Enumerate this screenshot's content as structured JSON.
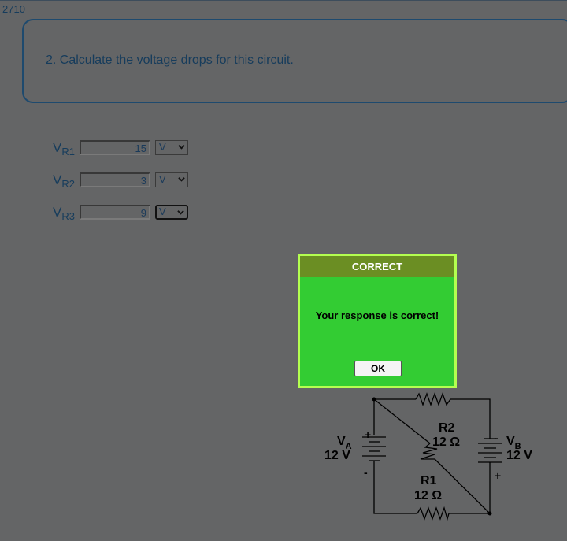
{
  "page": {
    "id": "2710"
  },
  "question": {
    "text": "2. Calculate the voltage drops for this circuit."
  },
  "answers": [
    {
      "label_main": "V",
      "label_sub": "R1",
      "value": "15",
      "unit": "V"
    },
    {
      "label_main": "V",
      "label_sub": "R2",
      "value": "3",
      "unit": "V"
    },
    {
      "label_main": "V",
      "label_sub": "R3",
      "value": "9",
      "unit": "V"
    }
  ],
  "modal": {
    "title": "CORRECT",
    "message": "Your response is correct!",
    "ok_label": "OK"
  },
  "circuit": {
    "va_letter": "V",
    "va_sub": "A",
    "va_value": "12 V",
    "vb_letter": "V",
    "vb_sub": "B",
    "vb_value": "12 V",
    "r2_name": "R2",
    "r2_value": "12 Ω",
    "r1_name": "R1",
    "r1_value": "12 Ω",
    "plus": "+",
    "minus": "-"
  },
  "colors": {
    "background": "#646566",
    "text": "#163c5c",
    "modal_bg": "#33cc33",
    "modal_header": "#6b8e23",
    "modal_border": "#b4ff50"
  }
}
